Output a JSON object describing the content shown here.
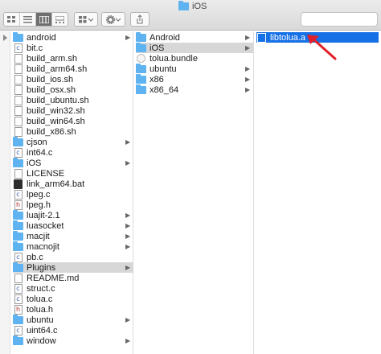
{
  "window": {
    "title": "iOS"
  },
  "toolbar": {
    "view_modes": [
      "icon-view-icon",
      "list-view-icon",
      "column-view-icon",
      "gallery-view-icon"
    ],
    "active_view": "column-view-icon",
    "arrange_icon": "grid-icon",
    "action_icon": "gear-icon",
    "share_icon": "share-icon"
  },
  "columns": [
    {
      "items": [
        {
          "label": "android",
          "icon": "folder",
          "has_children": true
        },
        {
          "label": "bit.c",
          "icon": "c-file"
        },
        {
          "label": "build_arm.sh",
          "icon": "doc"
        },
        {
          "label": "build_arm64.sh",
          "icon": "doc"
        },
        {
          "label": "build_ios.sh",
          "icon": "doc"
        },
        {
          "label": "build_osx.sh",
          "icon": "doc"
        },
        {
          "label": "build_ubuntu.sh",
          "icon": "doc"
        },
        {
          "label": "build_win32.sh",
          "icon": "doc"
        },
        {
          "label": "build_win64.sh",
          "icon": "doc"
        },
        {
          "label": "build_x86.sh",
          "icon": "doc"
        },
        {
          "label": "cjson",
          "icon": "folder",
          "has_children": true
        },
        {
          "label": "int64.c",
          "icon": "c-file"
        },
        {
          "label": "iOS",
          "icon": "folder",
          "has_children": true
        },
        {
          "label": "LICENSE",
          "icon": "blank-doc"
        },
        {
          "label": "link_arm64.bat",
          "icon": "bat"
        },
        {
          "label": "lpeg.c",
          "icon": "c-file"
        },
        {
          "label": "lpeg.h",
          "icon": "h-file"
        },
        {
          "label": "luajit-2.1",
          "icon": "folder",
          "has_children": true
        },
        {
          "label": "luasocket",
          "icon": "folder",
          "has_children": true
        },
        {
          "label": "macjit",
          "icon": "folder",
          "has_children": true
        },
        {
          "label": "macnojit",
          "icon": "folder",
          "has_children": true
        },
        {
          "label": "pb.c",
          "icon": "c-file"
        },
        {
          "label": "Plugins",
          "icon": "folder",
          "has_children": true,
          "selected": "gray"
        },
        {
          "label": "README.md",
          "icon": "blank-doc"
        },
        {
          "label": "struct.c",
          "icon": "c-file"
        },
        {
          "label": "tolua.c",
          "icon": "c-file"
        },
        {
          "label": "tolua.h",
          "icon": "h-file"
        },
        {
          "label": "ubuntu",
          "icon": "folder",
          "has_children": true
        },
        {
          "label": "uint64.c",
          "icon": "c-file"
        },
        {
          "label": "window",
          "icon": "folder",
          "has_children": true
        }
      ]
    },
    {
      "items": [
        {
          "label": "Android",
          "icon": "folder",
          "has_children": true
        },
        {
          "label": "iOS",
          "icon": "folder",
          "has_children": true,
          "selected": "gray"
        },
        {
          "label": "tolua.bundle",
          "icon": "bundle"
        },
        {
          "label": "ubuntu",
          "icon": "folder",
          "has_children": true
        },
        {
          "label": "x86",
          "icon": "folder",
          "has_children": true
        },
        {
          "label": "x86_64",
          "icon": "folder",
          "has_children": true
        }
      ]
    },
    {
      "items": [
        {
          "label": "libtolua.a",
          "icon": "lib",
          "selected": "blue"
        }
      ]
    }
  ],
  "colors": {
    "selection_blue": "#1670e6",
    "selection_gray": "#d7d7d7",
    "folder": "#5fb3f0",
    "arrow": "#e0202a"
  }
}
